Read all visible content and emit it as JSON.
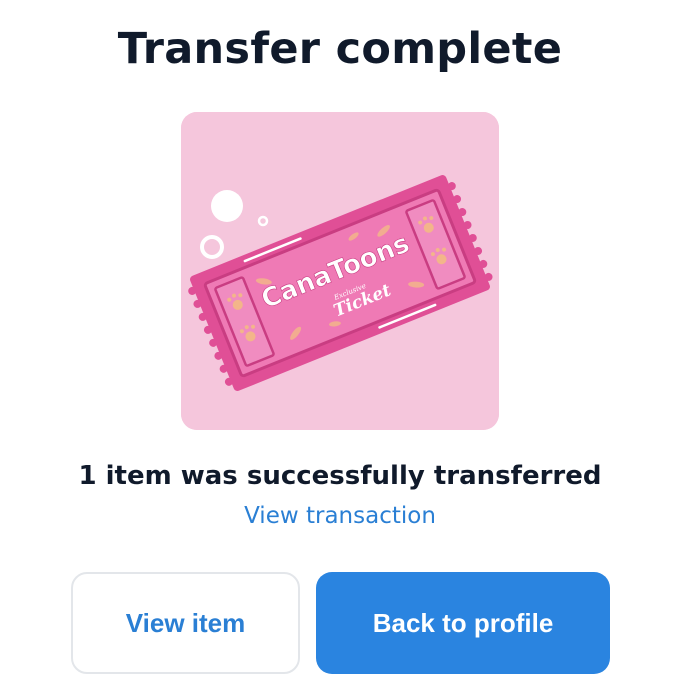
{
  "header": {
    "title": "Transfer complete"
  },
  "nft": {
    "image_icon": "canatoons-ticket-image",
    "brand_text": "CanaToons",
    "small_text": "Exclusive",
    "ticket_text": "Ticket",
    "background_color": "#f5c6dc",
    "ticket_color": "#e8529a"
  },
  "status": {
    "message": "1 item was successfully transferred",
    "view_transaction_link": "View transaction"
  },
  "actions": {
    "view_item_label": "View item",
    "back_to_profile_label": "Back to profile"
  },
  "colors": {
    "accent": "#2a84e0",
    "link": "#2a7fd4",
    "text": "#101a2b"
  }
}
